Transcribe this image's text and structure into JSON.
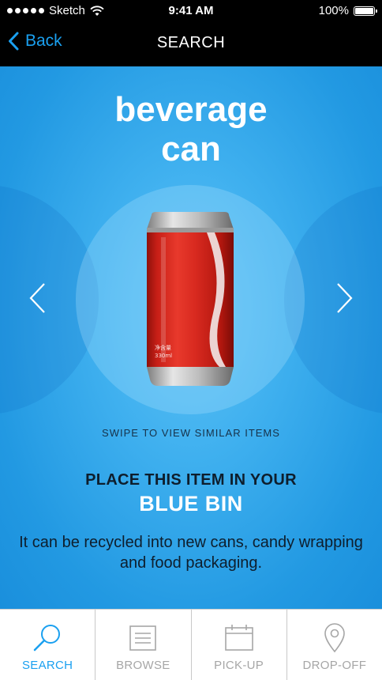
{
  "status_bar": {
    "carrier": "Sketch",
    "time": "9:41 AM",
    "battery": "100%"
  },
  "nav": {
    "back_label": "Back",
    "title": "SEARCH"
  },
  "item": {
    "title_line1": "beverage",
    "title_line2": "can",
    "image": "red-soda-can"
  },
  "swipe_hint": "SWIPE TO VIEW SIMILAR ITEMS",
  "instruction": "PLACE THIS ITEM IN YOUR",
  "bin_name": "BLUE BIN",
  "description": "It can be recycled into new cans, candy wrapping and food packaging.",
  "tabs": [
    {
      "label": "SEARCH",
      "icon": "search-icon",
      "active": true
    },
    {
      "label": "BROWSE",
      "icon": "list-icon",
      "active": false
    },
    {
      "label": "PICK-UP",
      "icon": "calendar-icon",
      "active": false
    },
    {
      "label": "DROP-OFF",
      "icon": "location-pin-icon",
      "active": false
    }
  ],
  "colors": {
    "accent": "#1aa0f0",
    "background_blue": "#2ba4ea",
    "can_red": "#d5271f",
    "inactive_tab": "#a6a6a6"
  }
}
